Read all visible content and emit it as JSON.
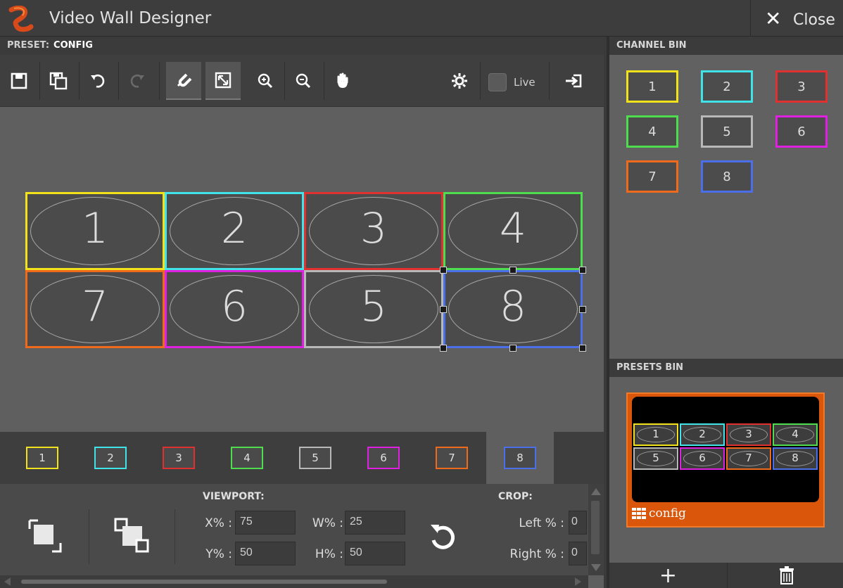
{
  "window": {
    "title": "Video Wall Designer",
    "close_label": "Close"
  },
  "preset": {
    "label": "PRESET:",
    "value": "CONFIG"
  },
  "toolbar": {
    "live_label": "Live",
    "icons": [
      "save-icon",
      "save-as-icon",
      "undo-icon",
      "redo-icon",
      "snap-magnet-icon",
      "fit-icon",
      "zoom-in-icon",
      "zoom-out-icon",
      "pan-hand-icon",
      "settings-gear-icon",
      "live-checkbox",
      "export-icon"
    ]
  },
  "wall": {
    "screens": [
      {
        "label": "1",
        "color": "#f2e21c"
      },
      {
        "label": "2",
        "color": "#3fe3e8"
      },
      {
        "label": "3",
        "color": "#e03030"
      },
      {
        "label": "4",
        "color": "#4fdc4f"
      },
      {
        "label": "7",
        "color": "#ef6a1a"
      },
      {
        "label": "6",
        "color": "#e020e0"
      },
      {
        "label": "5",
        "color": "#b8b8b8"
      },
      {
        "label": "8",
        "color": "#4a6fe8"
      }
    ]
  },
  "channel_tabs": [
    {
      "label": "1",
      "color": "#f2e21c"
    },
    {
      "label": "2",
      "color": "#3fe3e8"
    },
    {
      "label": "3",
      "color": "#e03030"
    },
    {
      "label": "4",
      "color": "#4fdc4f"
    },
    {
      "label": "5",
      "color": "#b8b8b8"
    },
    {
      "label": "6",
      "color": "#e020e0"
    },
    {
      "label": "7",
      "color": "#ef6a1a"
    },
    {
      "label": "8",
      "color": "#4a6fe8",
      "selected": true
    }
  ],
  "viewport": {
    "title": "VIEWPORT:",
    "x_label": "X% :",
    "x_value": "75",
    "w_label": "W% :",
    "w_value": "25",
    "y_label": "Y% :",
    "y_value": "50",
    "h_label": "H% :",
    "h_value": "50"
  },
  "crop": {
    "title": "CROP:",
    "left_label": "Left % :",
    "left_value": "0",
    "right_label": "Right % :",
    "right_value": "0"
  },
  "channel_bin": {
    "title": "CHANNEL BIN",
    "channels": [
      {
        "label": "1",
        "color": "#f2e21c"
      },
      {
        "label": "2",
        "color": "#3fe3e8"
      },
      {
        "label": "3",
        "color": "#e03030"
      },
      {
        "label": "4",
        "color": "#4fdc4f"
      },
      {
        "label": "5",
        "color": "#b8b8b8"
      },
      {
        "label": "6",
        "color": "#e020e0"
      },
      {
        "label": "7",
        "color": "#ef6a1a"
      },
      {
        "label": "8",
        "color": "#4a6fe8"
      }
    ]
  },
  "presets_bin": {
    "title": "PRESETS BIN",
    "presets": [
      {
        "name": "config",
        "accent": "#d9560b",
        "thumbnail": [
          "1",
          "2",
          "3",
          "4",
          "5",
          "6",
          "7",
          "8"
        ]
      }
    ],
    "add_label": "+",
    "delete_icon": "trash-icon"
  }
}
